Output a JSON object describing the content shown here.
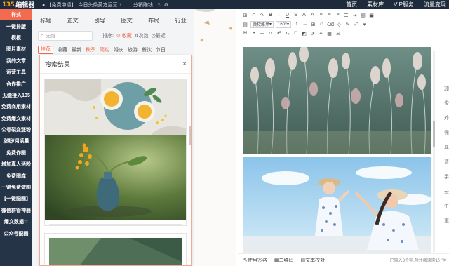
{
  "topbar": {
    "logo_mark": "135",
    "logo_text": "编辑器",
    "badge": "【免费申请】",
    "headline": "今日头条黄方运营",
    "promo": "分销赚钱",
    "nav": [
      "首页",
      "素材库",
      "VIP服务",
      "流量变现"
    ]
  },
  "rail": {
    "items": [
      "样式",
      "一键排版",
      "模板",
      "图片素材",
      "我的文章",
      "运营工具",
      "合作推广",
      "无缝接入135",
      "免费商用素材",
      "免费爆文素材",
      "公号裂变涨粉",
      "涨粉/阅读量",
      "免费作图",
      "增加真人活粉",
      "免费图库",
      "一键免费做图",
      "【一键配图】",
      "微信群管神器",
      "爆文数据☆",
      "公众号配图"
    ],
    "active_index": 0
  },
  "panel": {
    "tabs": [
      "标题",
      "正文",
      "引导",
      "图文",
      "布局",
      "行业"
    ],
    "search_placeholder": "无缝",
    "sort_label": "排序:",
    "sort_options": [
      "收藏",
      "次数",
      "最近"
    ],
    "filters": [
      "推荐",
      "收藏",
      "最新"
    ],
    "hot_tags": [
      "秋季",
      "简约"
    ],
    "tags": [
      "婚庆",
      "旅游",
      "餐饮",
      "节日"
    ]
  },
  "results": {
    "title": "搜索结果"
  },
  "editor": {
    "font_family": "微软雅黑",
    "font_size": "16px",
    "status": [
      "使用签名",
      "二维码",
      "文本校对"
    ],
    "status_right": "已输入3个字,预计阅读需1分钟",
    "side_labels": [
      "加",
      "俊",
      "外",
      "保",
      "尊",
      "清",
      "手",
      "云",
      "生",
      "更"
    ]
  },
  "colors": {
    "accent": "#f26b4f",
    "topbar_bg": "#1e2b3c",
    "rail_bg": "#263447"
  }
}
